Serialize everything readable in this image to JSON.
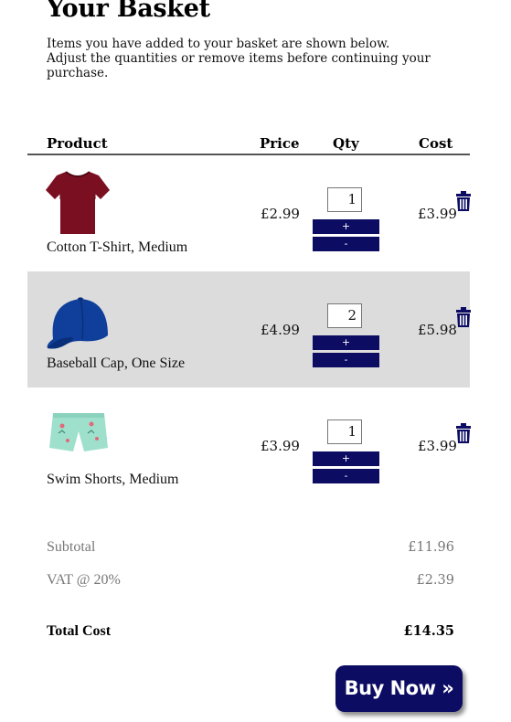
{
  "page": {
    "title": "Your Basket",
    "intro_lines": [
      "Items you have added to your basket are shown below.",
      "Adjust the quantities or remove items before continuing your",
      "purchase."
    ]
  },
  "table": {
    "headers": {
      "product": "Product",
      "price": "Price",
      "qty": "Qty",
      "cost": "Cost"
    },
    "items": [
      {
        "name": "Cotton T-Shirt, Medium",
        "price": "£2.99",
        "qty": "1",
        "cost": "£3.99",
        "plus": "+",
        "minus": "-",
        "icon": "tshirt-icon",
        "color": "#7a0f22"
      },
      {
        "name": "Baseball Cap, One Size",
        "price": "£4.99",
        "qty": "2",
        "cost": "£5.98",
        "plus": "+",
        "minus": "-",
        "icon": "cap-icon",
        "color": "#0f3f9a"
      },
      {
        "name": "Swim Shorts, Medium",
        "price": "£3.99",
        "qty": "1",
        "cost": "£3.99",
        "plus": "+",
        "minus": "-",
        "icon": "shorts-icon",
        "color": "#9fe0cd"
      }
    ]
  },
  "summary": {
    "subtotal_label": "Subtotal",
    "subtotal_value": "£11.96",
    "vat_label": "VAT @ 20%",
    "vat_value": "£2.39",
    "total_label": "Total Cost",
    "total_value": "£14.35"
  },
  "actions": {
    "buy_now_label": "Buy Now »"
  },
  "colors": {
    "accent": "#0c0c63",
    "alt_row": "#dcdcdc"
  }
}
